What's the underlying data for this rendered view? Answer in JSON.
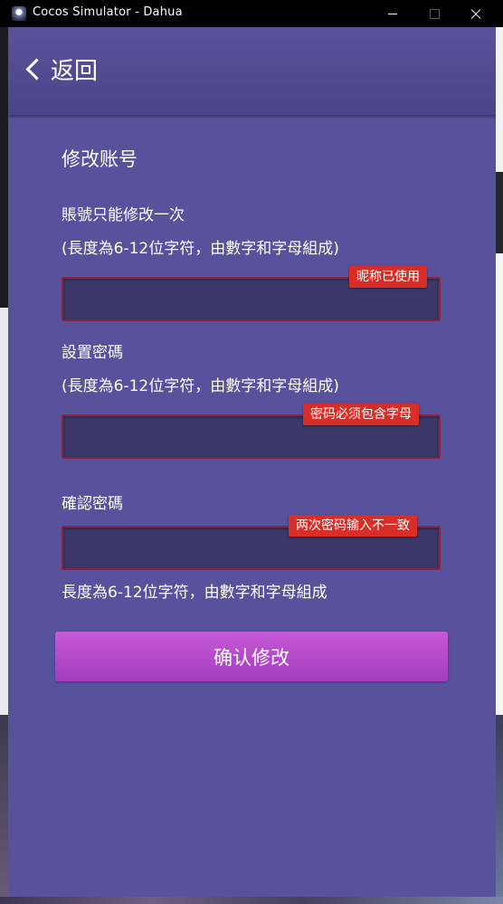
{
  "window": {
    "title": "Cocos Simulator - Dahua"
  },
  "header": {
    "back_label": "返回"
  },
  "form": {
    "section_title": "修改账号",
    "account": {
      "label": "賬號只能修改一次",
      "hint": "(長度為6-12位字符，由數字和字母組成)",
      "value": "",
      "error": "昵称已使用"
    },
    "password": {
      "label": "設置密碼",
      "hint": "(長度為6-12位字符，由數字和字母組成)",
      "value": "",
      "error": "密码必须包含字母"
    },
    "confirm_password": {
      "label": "確認密碼",
      "value": "",
      "error": "两次密码输入不一致",
      "hint_below": "長度為6-12位字符，由數字和字母組成"
    },
    "submit_label": "确认修改"
  },
  "colors": {
    "background": "#58519c",
    "input_bg": "#3c3869",
    "input_border": "#8c2241",
    "error_badge": "#d92d28",
    "button": "#b64bcb"
  }
}
